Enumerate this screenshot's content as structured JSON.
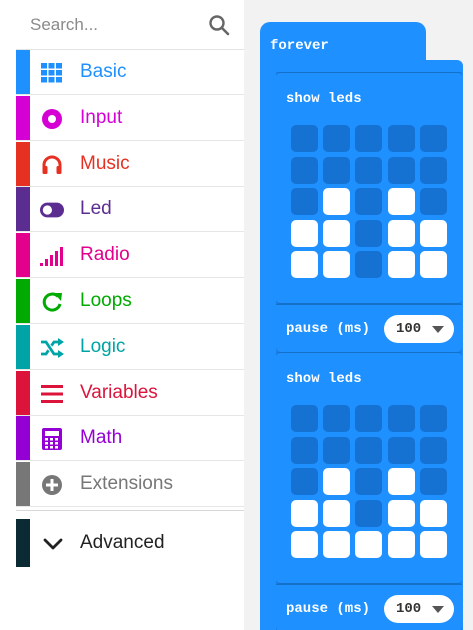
{
  "search": {
    "placeholder": "Search..."
  },
  "categories": [
    {
      "id": "basic",
      "label": "Basic",
      "color": "#1e90ff",
      "icon": "grid-icon"
    },
    {
      "id": "input",
      "label": "Input",
      "color": "#d400d4",
      "icon": "target-icon"
    },
    {
      "id": "music",
      "label": "Music",
      "color": "#e63022",
      "icon": "headphones-icon"
    },
    {
      "id": "led",
      "label": "Led",
      "color": "#5c2d91",
      "icon": "toggle-icon"
    },
    {
      "id": "radio",
      "label": "Radio",
      "color": "#e3008c",
      "icon": "signal-bars-icon"
    },
    {
      "id": "loops",
      "label": "Loops",
      "color": "#00aa00",
      "icon": "loop-arrow-icon"
    },
    {
      "id": "logic",
      "label": "Logic",
      "color": "#00a4a6",
      "icon": "shuffle-icon"
    },
    {
      "id": "variables",
      "label": "Variables",
      "color": "#dc143c",
      "icon": "lines-icon"
    },
    {
      "id": "math",
      "label": "Math",
      "color": "#9400d3",
      "icon": "calculator-icon"
    },
    {
      "id": "extensions",
      "label": "Extensions",
      "color": "#777777",
      "icon": "plus-circle-icon"
    }
  ],
  "advanced": {
    "label": "Advanced",
    "icon": "chevron-down-icon"
  },
  "workspace": {
    "forever_label": "forever",
    "blocks": [
      {
        "show_label": "show leds",
        "leds": [
          [
            0,
            0,
            0,
            0,
            0
          ],
          [
            0,
            0,
            0,
            0,
            0
          ],
          [
            0,
            1,
            0,
            1,
            0
          ],
          [
            1,
            1,
            0,
            1,
            1
          ],
          [
            1,
            1,
            0,
            1,
            1
          ]
        ],
        "pause_label": "pause (ms)",
        "pause_value": "100"
      },
      {
        "show_label": "show leds",
        "leds": [
          [
            0,
            0,
            0,
            0,
            0
          ],
          [
            0,
            0,
            0,
            0,
            0
          ],
          [
            0,
            1,
            0,
            1,
            0
          ],
          [
            1,
            1,
            0,
            1,
            1
          ],
          [
            1,
            1,
            1,
            1,
            1
          ]
        ],
        "pause_label": "pause (ms)",
        "pause_value": "100"
      }
    ]
  }
}
